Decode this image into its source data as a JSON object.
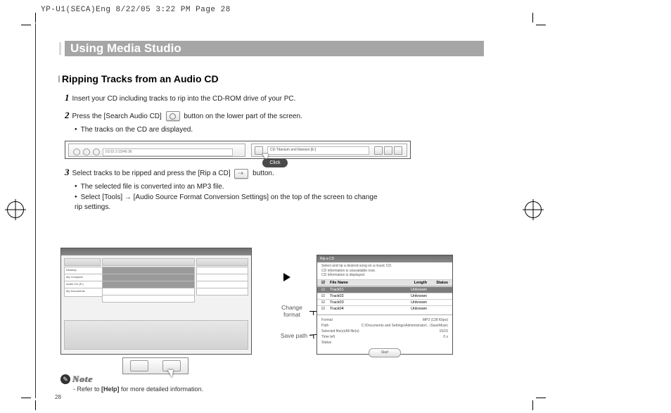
{
  "meta": {
    "header": "YP-U1(SECA)Eng  8/22/05 3:22 PM  Page 28"
  },
  "title": "Using Media Studio",
  "section": "Ripping Tracks from an Audio CD",
  "steps": {
    "s1": {
      "num": "1",
      "text": "Insert your CD including tracks to rip into the CD-ROM drive of your PC."
    },
    "s2": {
      "num": "2",
      "text_a": "Press the [Search Audio CD] ",
      "text_b": " button on the lower part of the screen.",
      "bullet1": "The tracks on the CD are displayed."
    },
    "s3": {
      "num": "3",
      "text_a": "Select tracks to be ripped and press the [Rip a CD] ",
      "text_b": " button.",
      "bullet1": "The selected file is converted into an MP3 file.",
      "bullet2": "Select [Tools] → [Audio Source Format Conversion Settings] on the top of the screen to change rip settings."
    }
  },
  "shot1": {
    "slot_text": "01/15   3:15/46:36",
    "dropdown": "CD-Titanium and titanium [E:]",
    "click_label": "Click"
  },
  "shot3": {
    "title": "Rip a CD",
    "hint1": "Select and rip a desired song on a music CD.",
    "hint2": "CD information is unavailable now.",
    "hint3": "CD information is displayed.",
    "head": {
      "c2": "File Name",
      "c3": "Length",
      "c4": "Status"
    },
    "rows": [
      {
        "c1": "1",
        "c2": "Track01",
        "c3": "Unknown",
        "c4": ""
      },
      {
        "c1": "2",
        "c2": "Track02",
        "c3": "Unknown",
        "c4": ""
      },
      {
        "c1": "3",
        "c2": "Track03",
        "c3": "Unknown",
        "c4": ""
      },
      {
        "c1": "4",
        "c2": "Track04",
        "c3": "Unknown",
        "c4": ""
      }
    ],
    "lower": {
      "r1a": "Format",
      "r1b": "MP3 (128 Kbps)",
      "r2a": "Path",
      "r2b": "C:\\Documents and Settings\\Administrator\\...\\SaveMusic",
      "r3a": "Selected file(s)/All file(s)",
      "r3b": "15/15",
      "r4a": "Time left",
      "r4b": "0 s",
      "r5a": "Status",
      "r5b": ""
    },
    "start": "Start"
  },
  "annot": {
    "change_format": "Change format",
    "save_path": "Save path"
  },
  "note": {
    "label": "Note",
    "text": "- Refer to [Help] for more detailed information."
  },
  "page": "28"
}
